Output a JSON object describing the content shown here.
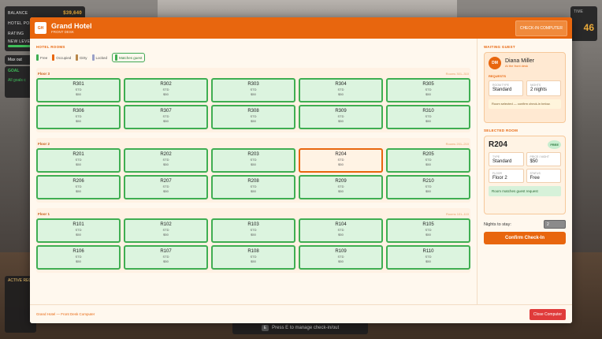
{
  "hud": {
    "balance_label": "BALANCE",
    "balance_value": "$39,640",
    "hotel_label": "HOTEL POP",
    "hotel_value": "",
    "rating_label": "RATING",
    "rating_value": "",
    "small_label": "NEW LEVEL",
    "extra": "Max out",
    "goals_title": "GOAL",
    "goals_text": "All goals c",
    "active_requests": "ACTIVE REQ",
    "timer_label": "TIME",
    "timer_value": "46"
  },
  "prompt": {
    "key": "E",
    "text": "Press E to manage check-in/out"
  },
  "window": {
    "logo": "GH",
    "title": "Grand Hotel",
    "subtitle": "FRONT DESK",
    "checkin_button": "CHECK-IN COMPUTER",
    "footer": "Grand Hotel — Front Desk Computer",
    "close_button": "Close Computer"
  },
  "rooms_panel": {
    "label": "HOTEL ROOMS",
    "legend": [
      {
        "label": "Free",
        "color": "#3fae52"
      },
      {
        "label": "Occupied",
        "color": "#e8660e"
      },
      {
        "label": "Dirty",
        "color": "#b9874a"
      },
      {
        "label": "Locked",
        "color": "#9aa0c8"
      },
      {
        "label": "Matches guest",
        "color": "#3fae52"
      }
    ],
    "floors": [
      {
        "name": "Floor 3",
        "range": "Rooms 301–310",
        "rooms": [
          {
            "n": "R301",
            "t": "STD",
            "p": "$50"
          },
          {
            "n": "R302",
            "t": "STD",
            "p": "$50"
          },
          {
            "n": "R303",
            "t": "STD",
            "p": "$50"
          },
          {
            "n": "R304",
            "t": "STD",
            "p": "$50"
          },
          {
            "n": "R305",
            "t": "STD",
            "p": "$50"
          },
          {
            "n": "R306",
            "t": "STD",
            "p": "$50"
          },
          {
            "n": "R307",
            "t": "STD",
            "p": "$50"
          },
          {
            "n": "R308",
            "t": "STD",
            "p": "$50"
          },
          {
            "n": "R309",
            "t": "STD",
            "p": "$50"
          },
          {
            "n": "R310",
            "t": "STD",
            "p": "$50"
          }
        ]
      },
      {
        "name": "Floor 2",
        "range": "Rooms 201–210",
        "rooms": [
          {
            "n": "R201",
            "t": "STD",
            "p": "$50"
          },
          {
            "n": "R202",
            "t": "STD",
            "p": "$50"
          },
          {
            "n": "R203",
            "t": "STD",
            "p": "$50"
          },
          {
            "n": "R204",
            "t": "STD",
            "p": "$50",
            "selected": true
          },
          {
            "n": "R205",
            "t": "STD",
            "p": "$50"
          },
          {
            "n": "R206",
            "t": "STD",
            "p": "$50"
          },
          {
            "n": "R207",
            "t": "STD",
            "p": "$50"
          },
          {
            "n": "R208",
            "t": "STD",
            "p": "$50"
          },
          {
            "n": "R209",
            "t": "STD",
            "p": "$50"
          },
          {
            "n": "R210",
            "t": "STD",
            "p": "$50"
          }
        ]
      },
      {
        "name": "Floor 1",
        "range": "Rooms 101–110",
        "rooms": [
          {
            "n": "R101",
            "t": "STD",
            "p": "$50"
          },
          {
            "n": "R102",
            "t": "STD",
            "p": "$50"
          },
          {
            "n": "R103",
            "t": "STD",
            "p": "$50"
          },
          {
            "n": "R104",
            "t": "STD",
            "p": "$50"
          },
          {
            "n": "R105",
            "t": "STD",
            "p": "$50"
          },
          {
            "n": "R106",
            "t": "STD",
            "p": "$50"
          },
          {
            "n": "R107",
            "t": "STD",
            "p": "$50"
          },
          {
            "n": "R108",
            "t": "STD",
            "p": "$50"
          },
          {
            "n": "R109",
            "t": "STD",
            "p": "$50"
          },
          {
            "n": "R110",
            "t": "STD",
            "p": "$50"
          }
        ]
      }
    ]
  },
  "guest": {
    "section_label": "WAITING GUEST",
    "initials": "DM",
    "name": "Diana Miller",
    "sub": "At the front desk",
    "request_label": "REQUESTS",
    "room_type_label": "ROOM TYPE",
    "room_type": "Standard",
    "nights_label": "NIGHTS",
    "nights": "2 nights",
    "note": "Room selected — confirm check-in below."
  },
  "selected_room": {
    "section_label": "SELECTED ROOM",
    "number": "R204",
    "badge": "FREE",
    "type_label": "TYPE",
    "type": "Standard",
    "price_label": "PRICE / NIGHT",
    "price": "$50",
    "floor_label": "FLOOR",
    "floor": "Floor 2",
    "status_label": "STATUS",
    "status": "Free",
    "match_note": "Room matches guest request"
  },
  "checkin": {
    "nights_label": "Nights to stay:",
    "nights_value": "2",
    "confirm_button": "Confirm Check-In"
  }
}
